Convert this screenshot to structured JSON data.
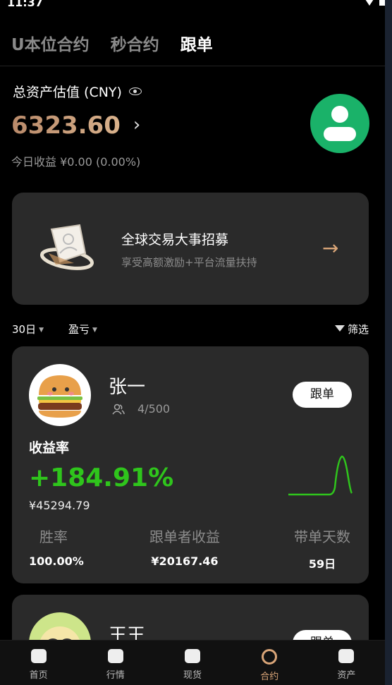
{
  "status": {
    "time": "11:37"
  },
  "tabs": [
    {
      "label": "U本位合约",
      "active": false
    },
    {
      "label": "秒合约",
      "active": false
    },
    {
      "label": "跟单",
      "active": true
    }
  ],
  "asset": {
    "label": "总资产估值 (CNY)",
    "value": "6323.60",
    "today": "今日收益 ¥0.00 (0.00%)"
  },
  "banner": {
    "title": "全球交易大事招募",
    "subtitle": "享受高额激励+平台流量扶持"
  },
  "filters": {
    "period": "30日",
    "sort": "盈亏",
    "filter": "筛选"
  },
  "traders": [
    {
      "name": "张一",
      "followers": "4/500",
      "follow_label": "跟单",
      "yield_label": "收益率",
      "yield": "+184.91%",
      "amount": "¥45294.79",
      "stats": [
        {
          "label": "胜率",
          "value": "100.00%"
        },
        {
          "label": "跟单者收益",
          "value": "¥20167.46"
        },
        {
          "label": "带单天数",
          "value": "59日"
        }
      ]
    },
    {
      "name": "王王",
      "follow_label": "跟单"
    }
  ],
  "nav": [
    {
      "label": "首页",
      "icon": "home-icon",
      "active": false
    },
    {
      "label": "行情",
      "icon": "market-icon",
      "active": false
    },
    {
      "label": "现货",
      "icon": "spot-icon",
      "active": false
    },
    {
      "label": "合约",
      "icon": "contract-icon",
      "active": true
    },
    {
      "label": "资产",
      "icon": "wallet-icon",
      "active": false
    }
  ],
  "colors": {
    "accent": "#d9a578",
    "positive": "#2fc51c",
    "card": "#2a2a2a",
    "avatar": "#1ab269"
  }
}
